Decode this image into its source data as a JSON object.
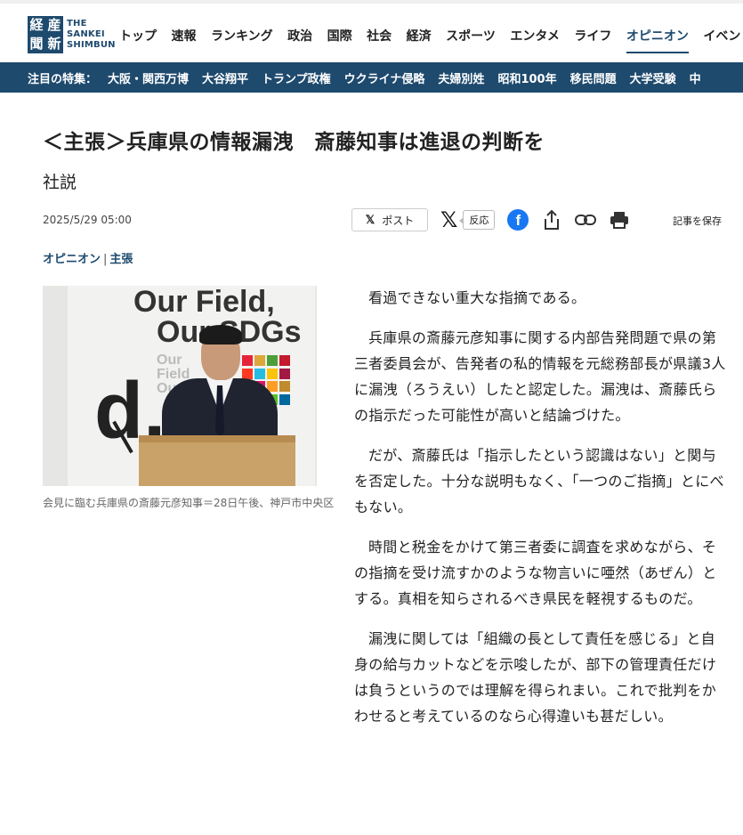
{
  "site": {
    "logo_chars": [
      "産",
      "経",
      "新",
      "聞"
    ],
    "logo_text": [
      "THE",
      "SANKEI",
      "SHIMBUN"
    ],
    "brand_color": "#1e4a6e"
  },
  "nav": {
    "items": [
      "トップ",
      "速報",
      "ランキング",
      "政治",
      "国際",
      "社会",
      "経済",
      "スポーツ",
      "エンタメ",
      "ライフ",
      "オピニオン",
      "イベント"
    ],
    "active": "オピニオン"
  },
  "features": {
    "label": "注目の特集：",
    "items": [
      "大阪・関西万博",
      "大谷翔平",
      "トランプ政権",
      "ウクライナ侵略",
      "夫婦別姓",
      "昭和100年",
      "移民問題",
      "大学受験",
      "中"
    ]
  },
  "article": {
    "headline": "＜主張＞兵庫県の情報漏洩　斎藤知事は進退の判断を",
    "subhead": "社説",
    "date": "2025/5/29 05:00",
    "category_main": "オピニオン",
    "category_sep": "|",
    "category_sub": "主張",
    "photo": {
      "sign_line1": "Our Field,",
      "sign_line2": "Our SDGs",
      "sign_bg": [
        "Our",
        "Field",
        "Our"
      ],
      "sign_letter": "d,"
    },
    "caption": "会見に臨む兵庫県の斎藤元彦知事＝28日午後、神戸市中央区",
    "paragraphs": [
      "看過できない重大な指摘である。",
      "兵庫県の斎藤元彦知事に関する内部告発問題で県の第三者委員会が、告発者の私的情報を元総務部長が県議3人に漏洩（ろうえい）したと認定した。漏洩は、斎藤氏らの指示だった可能性が高いと結論づけた。",
      "だが、斎藤氏は「指示したという認識はない」と関与を否定した。十分な説明もなく、「一つのご指摘」とにべもない。",
      "時間と税金をかけて第三者委に調査を求めながら、その指摘を受け流すかのような物言いに唖然（あぜん）とする。真相を知らされるべき県民を軽視するものだ。",
      "漏洩に関しては「組織の長として責任を感じる」と自身の給与カットなどを示唆したが、部下の管理責任だけは負うというのでは理解を得られまい。これで批判をかわせると考えているのなら心得違いも甚だしい。"
    ]
  },
  "share": {
    "post_icon": "𝕏",
    "post_label": "ポスト",
    "x_icon": "𝕏",
    "reaction_label": "反応",
    "fb_letter": "f",
    "save_label": "記事を保存"
  }
}
